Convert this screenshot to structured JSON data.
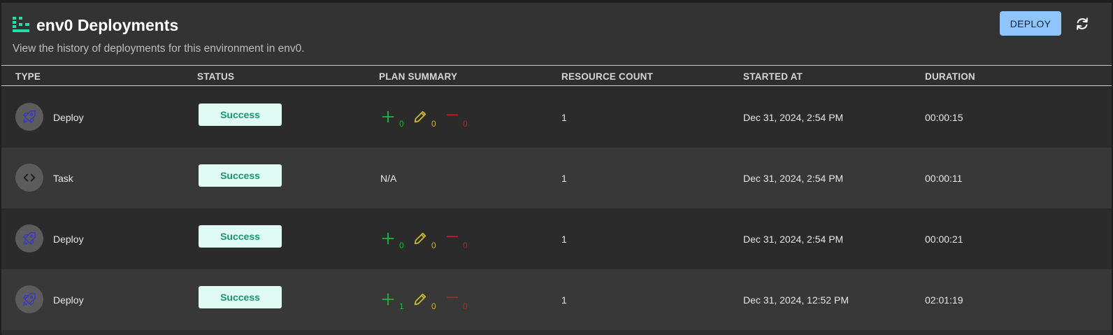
{
  "header": {
    "title": "env0 Deployments",
    "subtitle": "View the history of deployments for this environment in env0.",
    "deploy_label": "DEPLOY",
    "logo_icon": "env0-logo-icon",
    "refresh_icon": "refresh-icon"
  },
  "colors": {
    "accent": "#8ec5ff",
    "logo": "#1ee3a8",
    "success_bg": "#e0fbf4",
    "success_text": "#16966b",
    "add": "#1bb73e",
    "change": "#c8b62a",
    "destroy": "#c0201e",
    "deploy_icon": "#3b35c9"
  },
  "table": {
    "columns": [
      "TYPE",
      "STATUS",
      "PLAN SUMMARY",
      "RESOURCE COUNT",
      "STARTED AT",
      "DURATION"
    ],
    "rows": [
      {
        "type": "Deploy",
        "icon": "rocket-icon",
        "status": "Success",
        "plan": {
          "add": "0",
          "change": "0",
          "destroy": "0"
        },
        "resource_count": "1",
        "started_at": "Dec 31, 2024, 2:54 PM",
        "duration": "00:00:15"
      },
      {
        "type": "Task",
        "icon": "code-icon",
        "status": "Success",
        "plan_na": "N/A",
        "resource_count": "1",
        "started_at": "Dec 31, 2024, 2:54 PM",
        "duration": "00:00:11"
      },
      {
        "type": "Deploy",
        "icon": "rocket-icon",
        "status": "Success",
        "plan": {
          "add": "0",
          "change": "0",
          "destroy": "0"
        },
        "resource_count": "1",
        "started_at": "Dec 31, 2024, 2:54 PM",
        "duration": "00:00:21"
      },
      {
        "type": "Deploy",
        "icon": "rocket-icon",
        "status": "Success",
        "plan": {
          "add": "1",
          "change": "0",
          "destroy": "0"
        },
        "resource_count": "1",
        "started_at": "Dec 31, 2024, 12:52 PM",
        "duration": "02:01:19"
      }
    ]
  }
}
